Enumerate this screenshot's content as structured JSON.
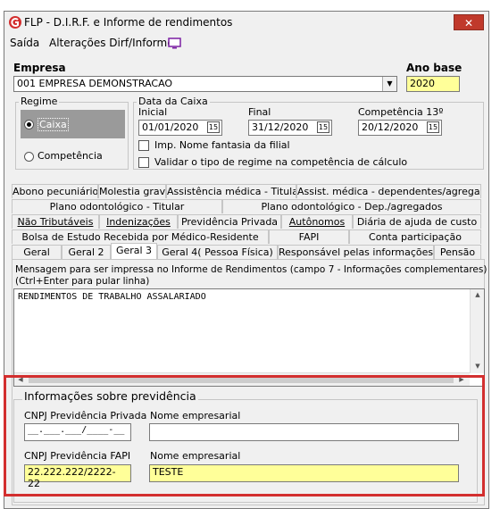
{
  "window": {
    "title": "FLP - D.I.R.F. e Informe de rendimentos",
    "close_glyph": "✕"
  },
  "menu": {
    "saida": "Saída",
    "alteracoes": "Alterações Dirf/Informe"
  },
  "empresa": {
    "label": "Empresa",
    "value": "001 EMPRESA DEMONSTRACAO"
  },
  "ano_base": {
    "label": "Ano base",
    "value": "2020"
  },
  "regime": {
    "title": "Regime",
    "caixa": "Caixa",
    "competencia": "Competência",
    "selected": "Caixa"
  },
  "data_caixa": {
    "title": "Data da Caixa",
    "inicial_label": "Inicial",
    "inicial_value": "01/01/2020",
    "final_label": "Final",
    "final_value": "31/12/2020",
    "comp13_label": "Competência 13º",
    "comp13_value": "20/12/2020",
    "cal_glyph": "15",
    "imp_nome": "Imp. Nome fantasia da filial",
    "validar": "Validar o tipo de regime na competência de cálculo"
  },
  "tabs": {
    "row1": [
      "Abono pecuniário",
      "Molestia grave",
      "Assistência médica - Titular",
      "Assist. médica - dependentes/agregados"
    ],
    "row2": [
      "Plano odontológico - Titular",
      "Plano odontológico - Dep./agregados"
    ],
    "row3": [
      "Não Tributáveis",
      "Indenizações",
      "Previdência Privada",
      "Autônomos",
      "Diária de ajuda de custo"
    ],
    "row4": [
      "Bolsa de Estudo Recebida por Médico-Residente",
      "FAPI",
      "Conta participação"
    ],
    "row5": [
      "Geral",
      "Geral 2",
      "Geral 3",
      "Geral 4( Pessoa Física)",
      "Responsável pelas informações",
      "Pensão"
    ],
    "active": "Geral 3"
  },
  "mensagem": {
    "label_line1": "Mensagem para ser impressa no Informe de Rendimentos (campo 7 - Informações complementares)",
    "label_line2": "(Ctrl+Enter para pular linha)",
    "text": "RENDIMENTOS DE TRABALHO ASSALARIADO"
  },
  "previdencia": {
    "title": "Informações sobre previdência",
    "cnpj_privada_label": "CNPJ Previdência Privada",
    "cnpj_privada_value": "__.___.___/____-__",
    "nome_privada_label": "Nome empresarial",
    "nome_privada_value": "",
    "cnpj_fapi_label": "CNPJ Previdência FAPI",
    "cnpj_fapi_value": "22.222.222/2222-22",
    "nome_fapi_label": "Nome empresarial",
    "nome_fapi_value": "TESTE"
  },
  "colors": {
    "highlight": "#ffff99",
    "annotation": "#d32f2f",
    "regime_selected_bg": "#9a9a9a"
  }
}
